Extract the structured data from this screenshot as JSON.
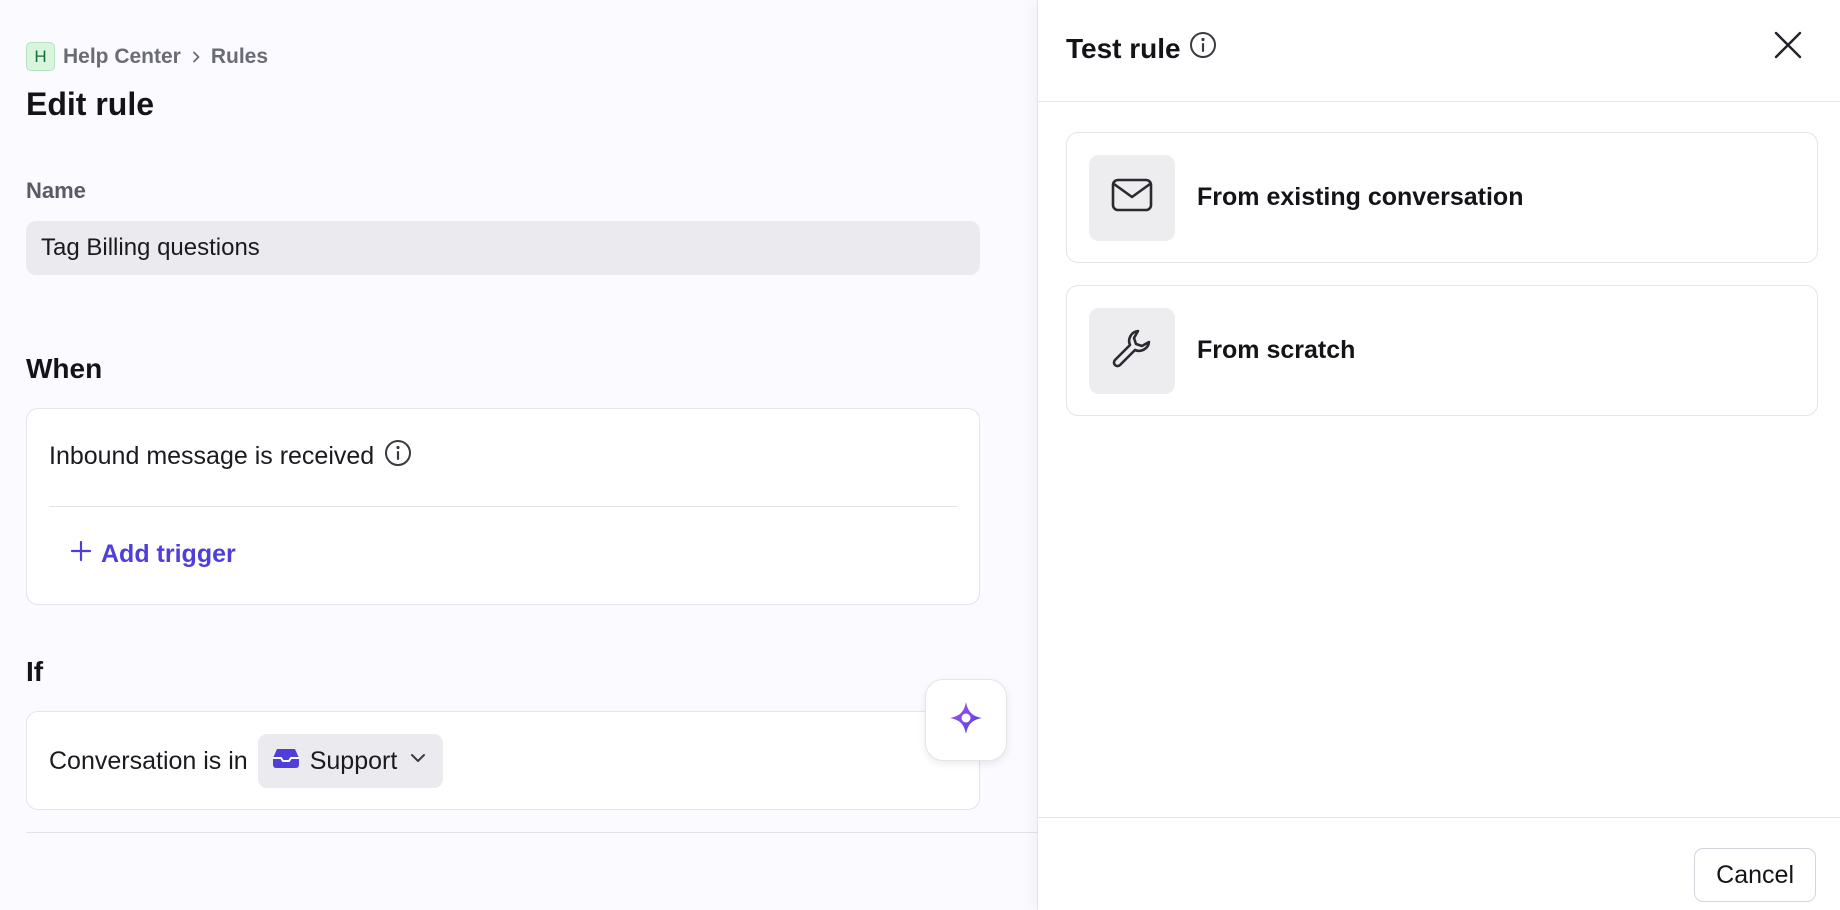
{
  "breadcrumb": {
    "workspace_initial": "H",
    "items": [
      "Help Center",
      "Rules"
    ]
  },
  "page": {
    "title": "Edit rule"
  },
  "name_field": {
    "label": "Name",
    "value": "Tag Billing questions"
  },
  "when": {
    "heading": "When",
    "trigger": "Inbound message is received",
    "add_trigger_label": "Add trigger"
  },
  "if": {
    "heading": "If",
    "condition_text": "Conversation is in",
    "inbox_value": "Support"
  },
  "panel": {
    "title": "Test rule",
    "options": [
      {
        "label": "From existing conversation",
        "icon": "mail-icon"
      },
      {
        "label": "From scratch",
        "icon": "wrench-icon"
      }
    ],
    "cancel_label": "Cancel"
  },
  "colors": {
    "accent": "#4f3fd8",
    "workspace_badge": "#d8f5de",
    "ai_gradient_start": "#a855f7",
    "ai_gradient_end": "#4f3fd8"
  }
}
